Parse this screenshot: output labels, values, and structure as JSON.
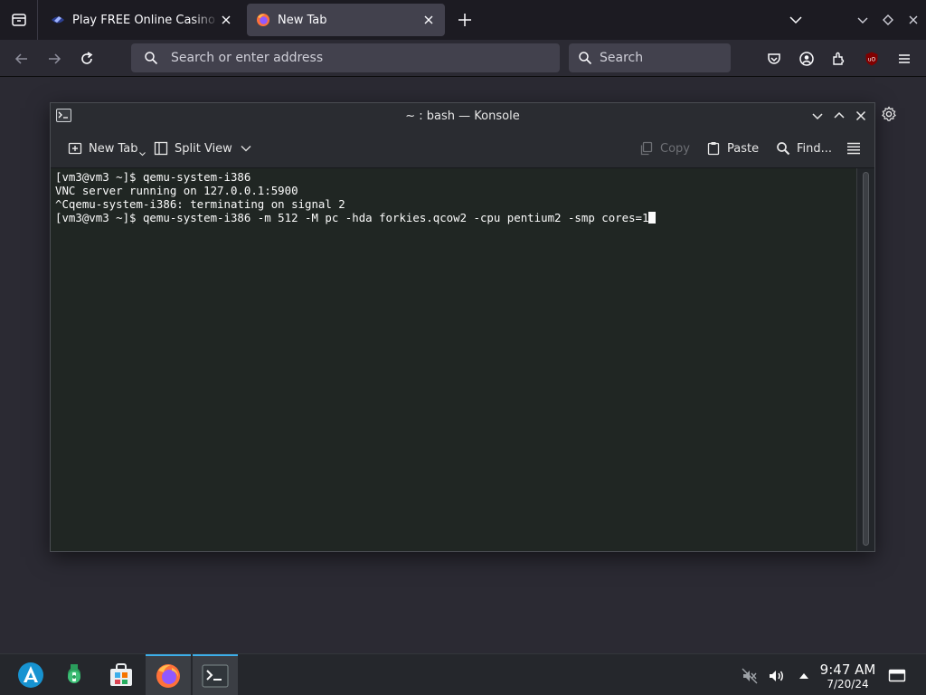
{
  "browser": {
    "tabs": [
      {
        "title": "Play FREE Online Casino games",
        "icon": "casino-favicon",
        "active": false
      },
      {
        "title": "New Tab",
        "icon": "firefox-favicon",
        "active": true
      }
    ],
    "url_placeholder": "Search or enter address",
    "search_placeholder": "Search",
    "toolbar_icons": [
      "pocket-icon",
      "account-icon",
      "extensions-icon",
      "ublock-icon",
      "menu-icon"
    ]
  },
  "konsole": {
    "title": "~ : bash — Konsole",
    "toolbar": {
      "new_tab": "New Tab",
      "split_view": "Split View",
      "copy": "Copy",
      "paste": "Paste",
      "find": "Find..."
    },
    "terminal_lines": [
      "[vm3@vm3 ~]$ qemu-system-i386",
      "VNC server running on 127.0.0.1:5900",
      "^Cqemu-system-i386: terminating on signal 2",
      "[vm3@vm3 ~]$ qemu-system-i386 -m 512 -M pc -hda forkies.qcow2 -cpu pentium2 -smp cores=1"
    ]
  },
  "taskbar": {
    "apps": [
      "app-launcher-icon",
      "system-settings-icon",
      "discover-icon",
      "firefox-icon",
      "konsole-icon"
    ],
    "time": "9:47 AM",
    "date": "7/20/24"
  },
  "colors": {
    "accent": "#3daee9",
    "terminal_bg": "#202623"
  }
}
